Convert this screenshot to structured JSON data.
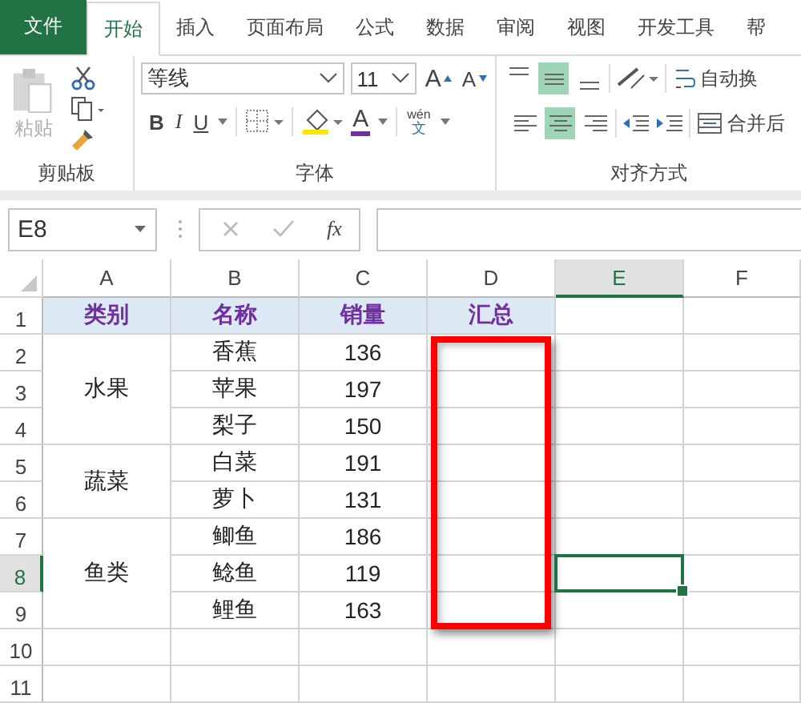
{
  "tabs": [
    {
      "label": "文件",
      "kind": "file",
      "selected": false
    },
    {
      "label": "开始",
      "kind": "tab",
      "selected": true
    },
    {
      "label": "插入",
      "kind": "tab",
      "selected": false
    },
    {
      "label": "页面布局",
      "kind": "tab",
      "selected": false
    },
    {
      "label": "公式",
      "kind": "tab",
      "selected": false
    },
    {
      "label": "数据",
      "kind": "tab",
      "selected": false
    },
    {
      "label": "审阅",
      "kind": "tab",
      "selected": false
    },
    {
      "label": "视图",
      "kind": "tab",
      "selected": false
    },
    {
      "label": "开发工具",
      "kind": "tab",
      "selected": false
    },
    {
      "label": "帮",
      "kind": "tab",
      "selected": false
    }
  ],
  "ribbon": {
    "clipboard": {
      "title": "剪贴板",
      "paste_label": "粘贴",
      "paste_disabled": true
    },
    "font": {
      "title": "字体",
      "font_name": "等线",
      "font_size": "11",
      "grow_label": "A",
      "shrink_label": "A",
      "bold_label": "B",
      "italic_label": "I",
      "underline_label": "U",
      "color_label": "A",
      "pinyin_label": "wén",
      "pinyin_char": "文"
    },
    "alignment": {
      "title": "对齐方式",
      "vertical": [
        {
          "selected": false
        },
        {
          "selected": true
        },
        {
          "selected": false
        }
      ],
      "horizontal": [
        {
          "selected": false
        },
        {
          "selected": true
        },
        {
          "selected": false
        }
      ],
      "wrap_label": "自动换",
      "merge_label": "合并后"
    }
  },
  "formula_bar": {
    "name_box": "E8",
    "fx_label": "fx"
  },
  "sheet": {
    "columns": [
      {
        "label": "A",
        "selected": false
      },
      {
        "label": "B",
        "selected": false
      },
      {
        "label": "C",
        "selected": false
      },
      {
        "label": "D",
        "selected": false
      },
      {
        "label": "E",
        "selected": true
      },
      {
        "label": "F",
        "selected": false
      }
    ],
    "rows": [
      {
        "label": "1",
        "selected": false
      },
      {
        "label": "2",
        "selected": false
      },
      {
        "label": "3",
        "selected": false
      },
      {
        "label": "4",
        "selected": false
      },
      {
        "label": "5",
        "selected": false
      },
      {
        "label": "6",
        "selected": false
      },
      {
        "label": "7",
        "selected": false
      },
      {
        "label": "8",
        "selected": true
      },
      {
        "label": "9",
        "selected": false
      },
      {
        "label": "10",
        "selected": false
      },
      {
        "label": "11",
        "selected": false
      }
    ],
    "headers": [
      {
        "text": "类别",
        "highlighted": false
      },
      {
        "text": "名称",
        "highlighted": false
      },
      {
        "text": "销量",
        "highlighted": false
      },
      {
        "text": "汇总",
        "highlighted": true
      }
    ],
    "groups": [
      {
        "category": "水果",
        "items": [
          {
            "name": "香蕉",
            "sales": "136"
          },
          {
            "name": "苹果",
            "sales": "197"
          },
          {
            "name": "梨子",
            "sales": "150"
          }
        ]
      },
      {
        "category": "蔬菜",
        "items": [
          {
            "name": "白菜",
            "sales": "191"
          },
          {
            "name": "萝卜",
            "sales": "131"
          }
        ]
      },
      {
        "category": "鱼类",
        "items": [
          {
            "name": "鲫鱼",
            "sales": "186"
          },
          {
            "name": "鲶鱼",
            "sales": "119"
          },
          {
            "name": "鲤鱼",
            "sales": "163"
          }
        ]
      }
    ]
  }
}
